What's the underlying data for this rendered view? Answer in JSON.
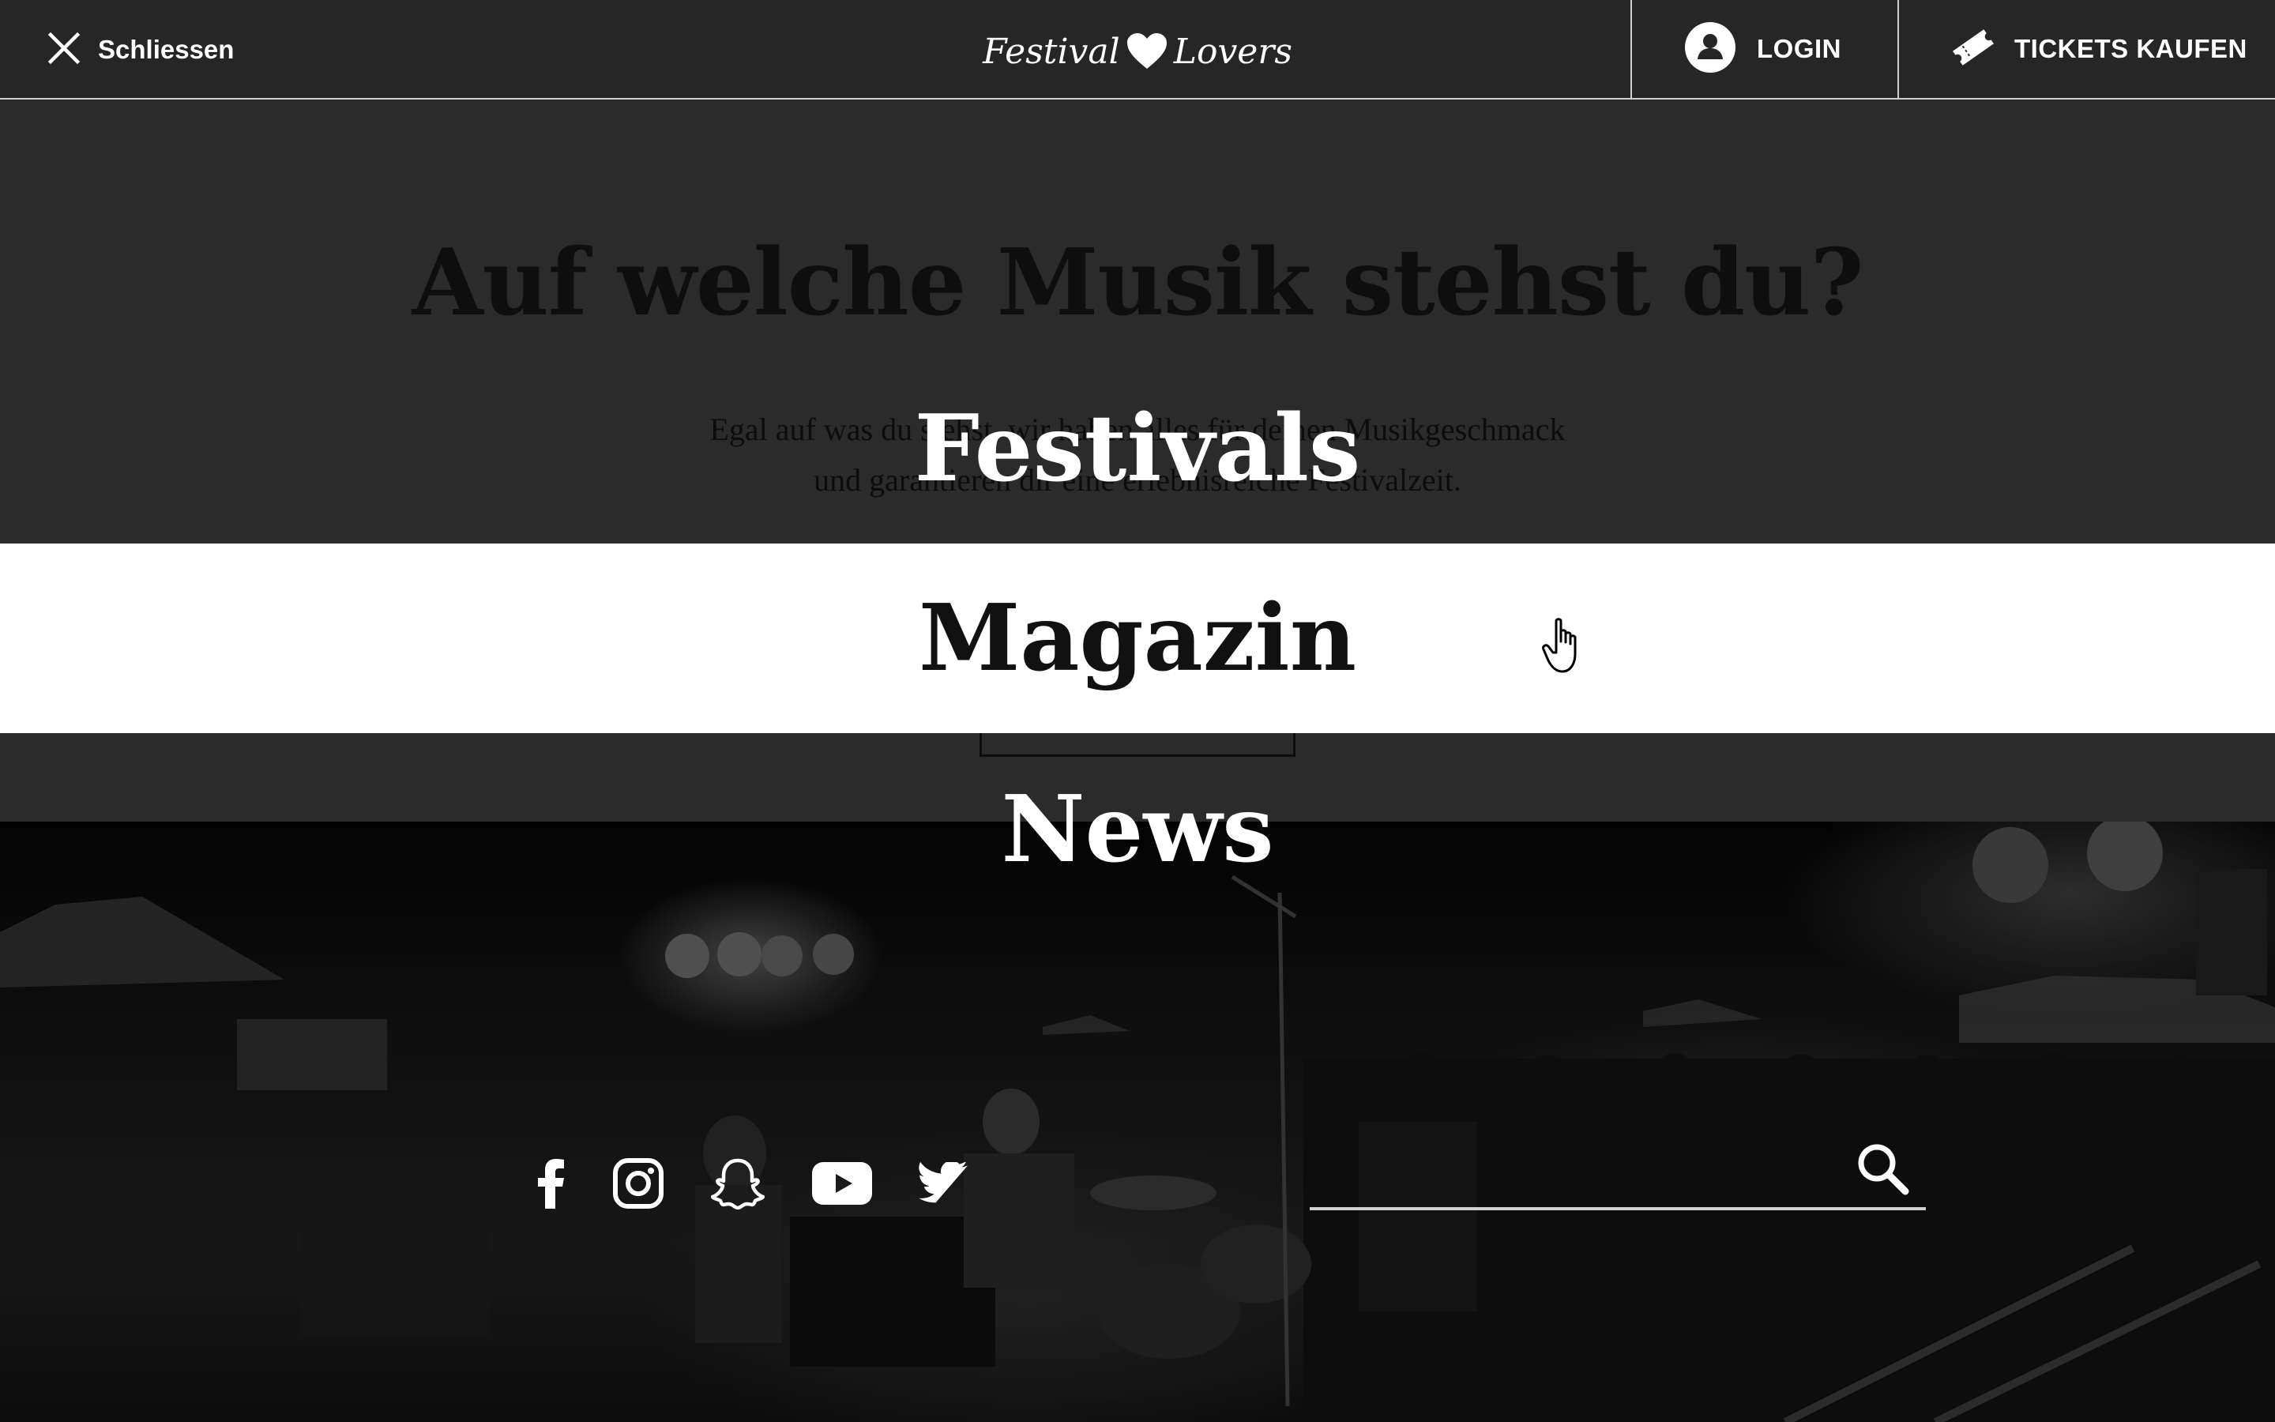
{
  "header": {
    "close_label": "Schliessen",
    "logo_left": "Festival",
    "logo_right": "Lovers",
    "login_label": "LOGIN",
    "tickets_label": "TICKETS KAUFEN"
  },
  "background_page": {
    "heading": "Auf welche Musik stehst du?",
    "subtext_line1": "Egal auf was du stehst, wir haben alles für deinen Musikgeschmack",
    "subtext_line2": "und garantieren dir eine erlebnisreiche Festivalzeit."
  },
  "menu": {
    "items": [
      {
        "label": "Festivals",
        "state": "normal"
      },
      {
        "label": "Magazin",
        "state": "hovered"
      },
      {
        "label": "News",
        "state": "normal"
      }
    ]
  },
  "social": {
    "icons": [
      "facebook-icon",
      "instagram-icon",
      "snapchat-icon",
      "youtube-icon",
      "twitter-icon"
    ]
  },
  "search": {
    "placeholder": "",
    "value": ""
  },
  "colors": {
    "header_bg": "#262626",
    "overlay_bg": "#2b2b2b",
    "highlight_bg": "#ffffff",
    "text_light": "#ffffff",
    "text_dark": "#111111"
  }
}
